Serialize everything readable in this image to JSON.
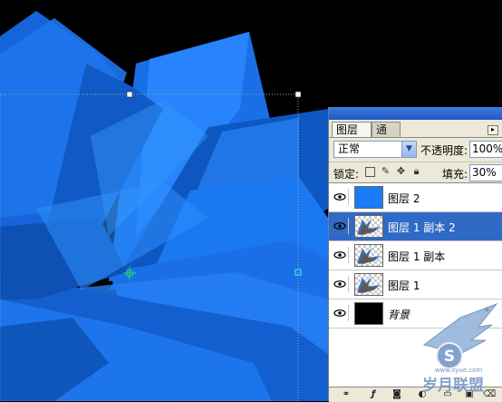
{
  "canvas": {
    "background_color": "#000000",
    "shape_colors": [
      "#1160d8",
      "#1a7cf0",
      "#2a8cff",
      "#0a4aa8",
      "#3a95ff"
    ]
  },
  "layers_panel": {
    "tabs": [
      {
        "label": "图层",
        "active": true
      },
      {
        "label": "通道",
        "active": false
      }
    ],
    "blend_mode": "正常",
    "opacity_label": "不透明度:",
    "opacity_value": "100%",
    "lock_label": "锁定:",
    "fill_label": "填充:",
    "fill_value": "30%",
    "layers": [
      {
        "name": "图层 2",
        "thumb": "blue-fill",
        "visible": true,
        "selected": false
      },
      {
        "name": "图层 1 副本 2",
        "thumb": "shape",
        "visible": true,
        "selected": true
      },
      {
        "name": "图层 1 副本",
        "thumb": "shape",
        "visible": true,
        "selected": false
      },
      {
        "name": "图层 1",
        "thumb": "shape",
        "visible": true,
        "selected": false
      },
      {
        "name": "背景",
        "thumb": "black-fill",
        "visible": true,
        "selected": false,
        "locked": true
      }
    ],
    "bottom_icons": [
      "link-icon",
      "fx-icon",
      "mask-icon",
      "adjustment-icon",
      "group-icon",
      "new-layer-icon",
      "trash-icon"
    ]
  },
  "watermark": {
    "text": "岁月联盟",
    "url_text": "www.syue.com"
  }
}
